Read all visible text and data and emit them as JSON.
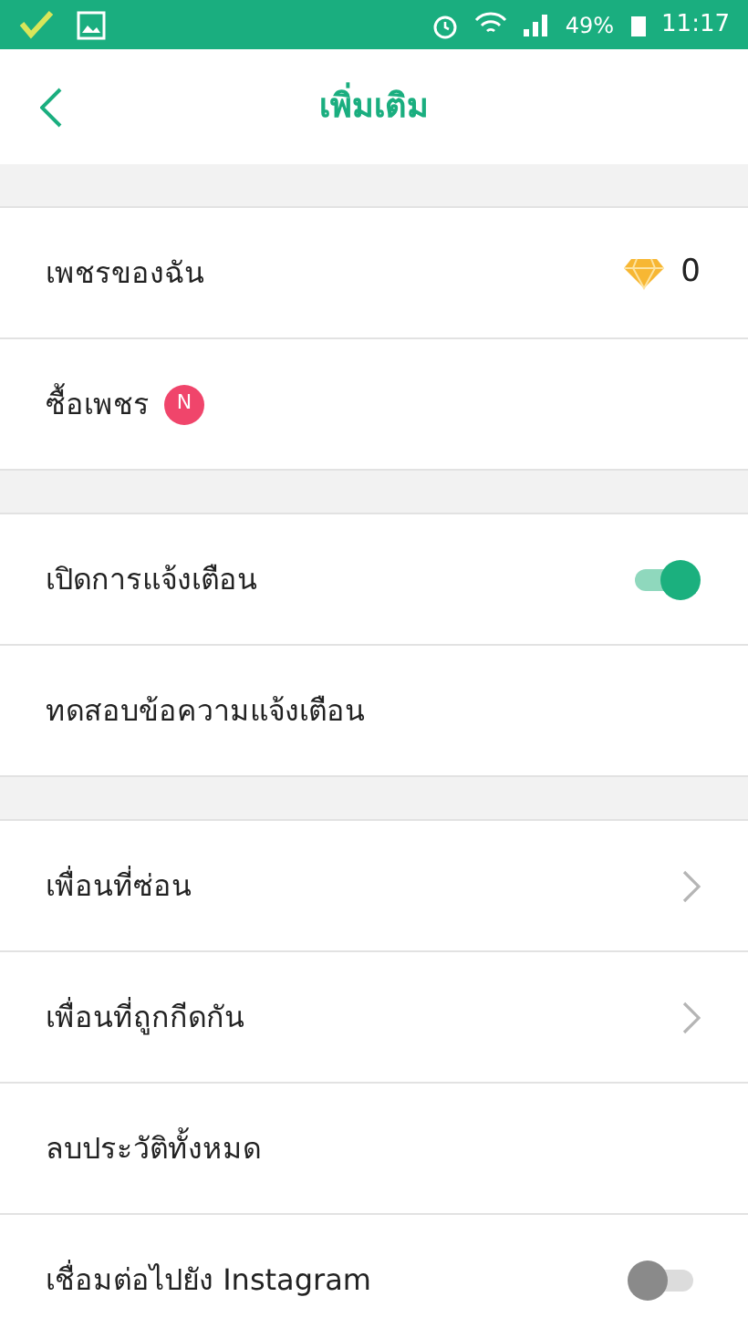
{
  "status_bar": {
    "battery": "49%",
    "time": "11:17"
  },
  "header": {
    "title": "เพิ่มเติม"
  },
  "sections": [
    {
      "items": [
        {
          "kind": "value",
          "label": "เพชรของฉัน",
          "value": "0"
        },
        {
          "kind": "badge",
          "label": "ซื้อเพชร",
          "badge": "N"
        }
      ]
    },
    {
      "items": [
        {
          "kind": "toggle",
          "label": "เปิดการแจ้งเตือน",
          "on": true
        },
        {
          "kind": "plain",
          "label": "ทดสอบข้อความแจ้งเตือน"
        }
      ]
    },
    {
      "items": [
        {
          "kind": "chevron",
          "label": "เพื่อนที่ซ่อน"
        },
        {
          "kind": "chevron",
          "label": "เพื่อนที่ถูกกีดกัน"
        },
        {
          "kind": "plain",
          "label": "ลบประวัติทั้งหมด"
        },
        {
          "kind": "toggle",
          "label": "เชื่อมต่อไปยัง Instagram",
          "on": false
        }
      ]
    }
  ]
}
